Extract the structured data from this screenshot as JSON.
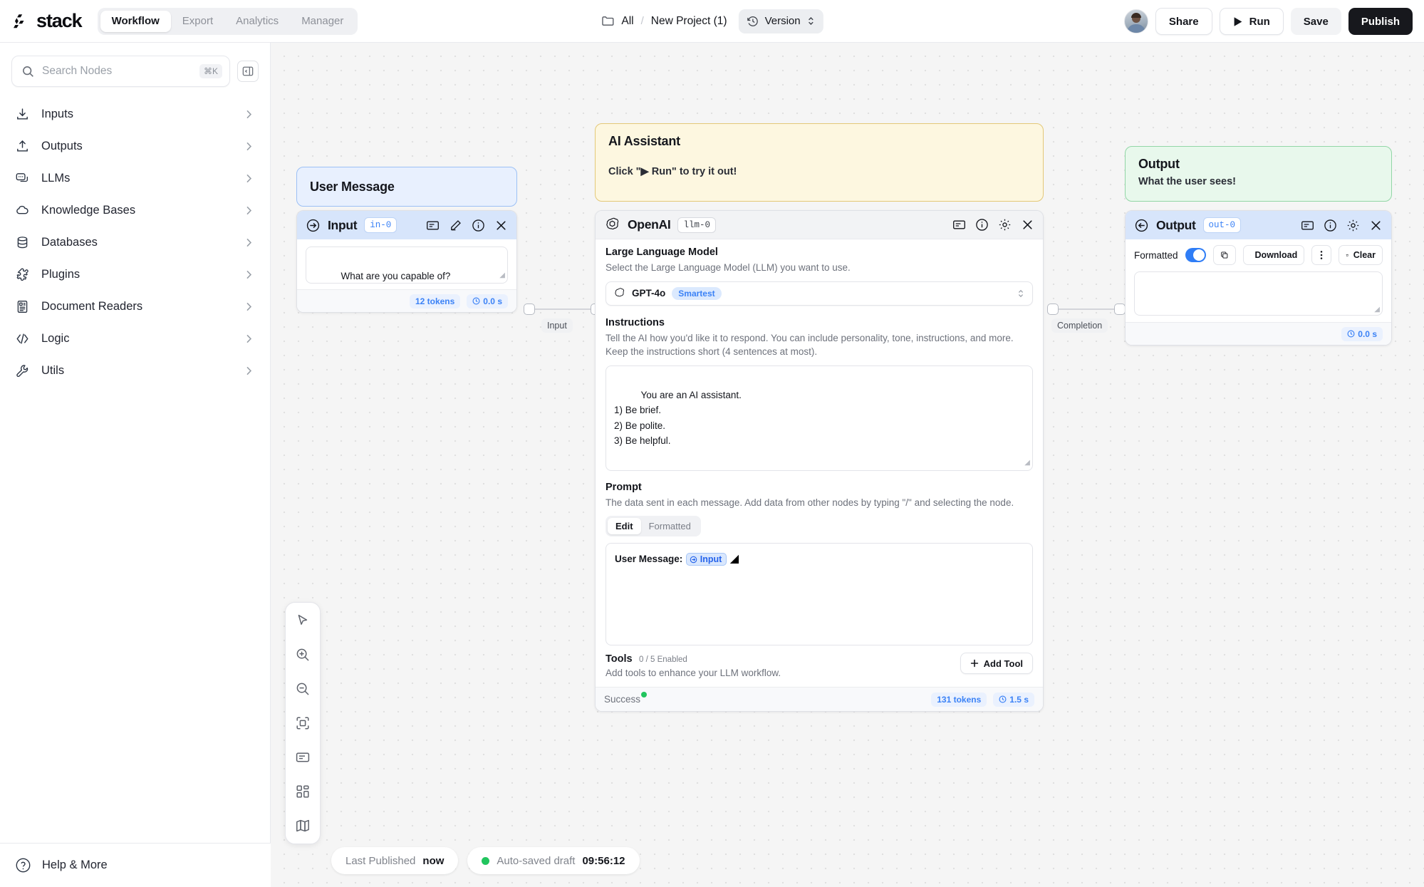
{
  "topbar": {
    "brand": "stack",
    "tabs": [
      {
        "label": "Workflow",
        "active": true
      },
      {
        "label": "Export",
        "active": false
      },
      {
        "label": "Analytics",
        "active": false
      },
      {
        "label": "Manager",
        "active": false
      }
    ],
    "breadcrumb": {
      "folder": "All",
      "separator": "/",
      "project": "New Project (1)"
    },
    "version_label": "Version",
    "share_label": "Share",
    "run_label": "Run",
    "save_label": "Save",
    "publish_label": "Publish"
  },
  "sidebar": {
    "search": {
      "placeholder": "Search Nodes",
      "shortcut": "⌘K"
    },
    "items": [
      {
        "label": "Inputs",
        "icon": "download-arrow-icon"
      },
      {
        "label": "Outputs",
        "icon": "upload-arrow-icon"
      },
      {
        "label": "LLMs",
        "icon": "chat-bubbles-icon"
      },
      {
        "label": "Knowledge Bases",
        "icon": "cloud-icon"
      },
      {
        "label": "Databases",
        "icon": "database-icon"
      },
      {
        "label": "Plugins",
        "icon": "puzzle-icon"
      },
      {
        "label": "Document Readers",
        "icon": "document-icon"
      },
      {
        "label": "Logic",
        "icon": "code-brackets-icon"
      },
      {
        "label": "Utils",
        "icon": "wrench-icon"
      }
    ],
    "help_label": "Help & More"
  },
  "canvas": {
    "notes": {
      "user_message": {
        "title": "User Message"
      },
      "ai_assistant": {
        "title": "AI Assistant",
        "subtitle": "Click \"▶ Run\" to try it out!"
      },
      "output": {
        "title": "Output",
        "subtitle": "What the user sees!"
      }
    },
    "input_node": {
      "name": "Input",
      "id": "in-0",
      "value": "What are you capable of?",
      "tokens": "12 tokens",
      "time": "0.0 s"
    },
    "llm_node": {
      "name": "OpenAI",
      "id": "llm-0",
      "model_section": {
        "title": "Large Language Model",
        "description": "Select the Large Language Model (LLM) you want to use.",
        "selected_model": "GPT-4o",
        "model_badge": "Smartest"
      },
      "instructions_section": {
        "title": "Instructions",
        "description": "Tell the AI how you'd like it to respond. You can include personality, tone, instructions, and more. Keep the instructions short (4 sentences at most).",
        "value": "You are an AI assistant.\n1) Be brief.\n2) Be polite.\n3) Be helpful."
      },
      "prompt_section": {
        "title": "Prompt",
        "description": "The data sent in each message. Add data from other nodes by typing \"/\" and selecting the node.",
        "tabs": [
          {
            "label": "Edit",
            "active": true
          },
          {
            "label": "Formatted",
            "active": false
          }
        ],
        "prompt_prefix": "User Message:",
        "prompt_chip": "Input"
      },
      "tools_section": {
        "title": "Tools",
        "count": "0 / 5 Enabled",
        "description": "Add tools to enhance your LLM workflow.",
        "add_label": "Add Tool"
      },
      "footer": {
        "status": "Success",
        "tokens": "131 tokens",
        "time": "1.5 s"
      }
    },
    "output_node": {
      "name": "Output",
      "id": "out-0",
      "formatted_label": "Formatted",
      "formatted_on": true,
      "download_label": "Download",
      "clear_label": "Clear",
      "value": "",
      "time": "0.0 s"
    },
    "edges": [
      {
        "label": "Input"
      },
      {
        "label": "Completion"
      }
    ],
    "tools": [
      {
        "icon": "cursor-icon"
      },
      {
        "icon": "zoom-in-icon"
      },
      {
        "icon": "zoom-out-icon"
      },
      {
        "icon": "fit-view-icon"
      },
      {
        "icon": "note-icon"
      },
      {
        "icon": "grid-icon"
      },
      {
        "icon": "minimap-icon"
      }
    ],
    "status": {
      "published_label": "Last Published",
      "published_value": "now",
      "autosave_label": "Auto-saved draft",
      "autosave_value": "09:56:12"
    }
  },
  "colors": {
    "accent_blue": "#3b82f6",
    "success_green": "#22c55e",
    "note_yellow": "#fdf7e0",
    "note_green": "#e8f8ec",
    "note_blue": "#e8f0fe",
    "publish_dark": "#17181d"
  }
}
